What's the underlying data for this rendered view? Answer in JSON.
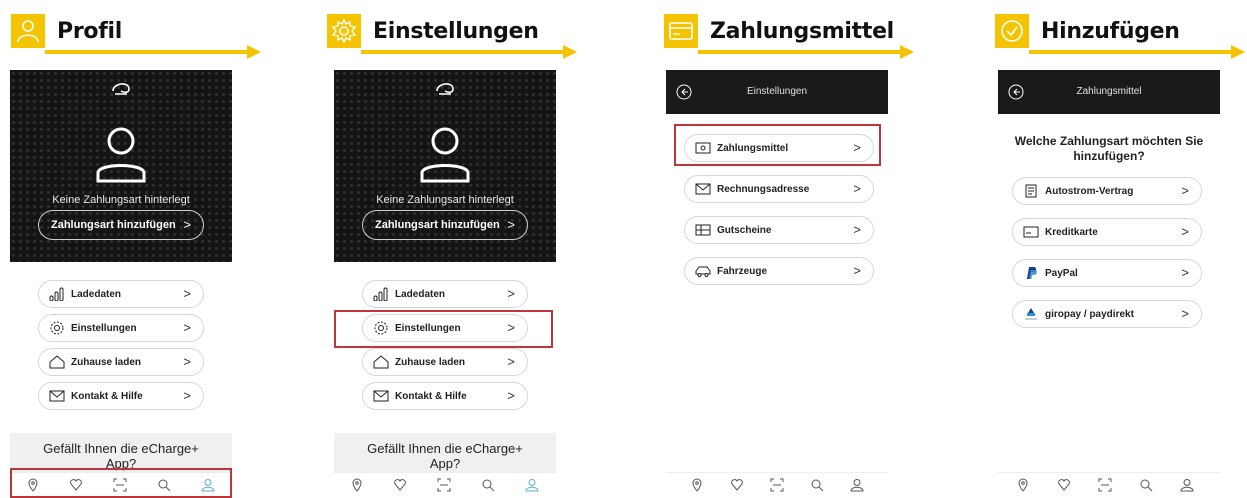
{
  "colors": {
    "accent": "#f5c400",
    "highlight": "#c0343c",
    "hero_bg": "#141414",
    "nav_active": "#5bb0d8"
  },
  "steps": [
    {
      "title": "Profil",
      "icon": "user-icon"
    },
    {
      "title": "Einstellungen",
      "icon": "gear-icon"
    },
    {
      "title": "Zahlungsmittel",
      "icon": "credit-card-icon"
    },
    {
      "title": "Hinzufügen",
      "icon": "checkmark-circle-icon"
    }
  ],
  "profile": {
    "no_payment_text": "Keine Zahlungsart hinterlegt",
    "add_payment_button": "Zahlungsart hinzufügen",
    "chevron": ">",
    "menu": [
      {
        "label": "Ladedaten",
        "icon": "bar-chart-icon"
      },
      {
        "label": "Einstellungen",
        "icon": "gear-icon"
      },
      {
        "label": "Zuhause laden",
        "icon": "house-icon"
      },
      {
        "label": "Kontakt & Hilfe",
        "icon": "mail-icon"
      }
    ],
    "promo_line1": "Gefällt Ihnen die eCharge+",
    "promo_line2": "App?"
  },
  "settings_screen": {
    "title": "Einstellungen",
    "menu": [
      {
        "label": "Zahlungsmittel",
        "icon": "credit-card-icon"
      },
      {
        "label": "Rechnungsadresse",
        "icon": "mail-icon"
      },
      {
        "label": "Gutscheine",
        "icon": "voucher-icon"
      },
      {
        "label": "Fahrzeuge",
        "icon": "car-icon"
      }
    ]
  },
  "payment_screen": {
    "title": "Zahlungsmittel",
    "question_line1": "Welche Zahlungsart möchten Sie",
    "question_line2": "hinzufügen?",
    "options": [
      {
        "label": "Autostrom-Vertrag",
        "icon": "contract-icon"
      },
      {
        "label": "Kreditkarte",
        "icon": "credit-card-icon"
      },
      {
        "label": "PayPal",
        "icon": "paypal-icon"
      },
      {
        "label": "giropay / paydirekt",
        "icon": "giropay-icon"
      }
    ]
  },
  "bottom_nav": [
    "map-pin-icon",
    "heart-icon",
    "scan-icon",
    "search-icon",
    "user-icon"
  ]
}
